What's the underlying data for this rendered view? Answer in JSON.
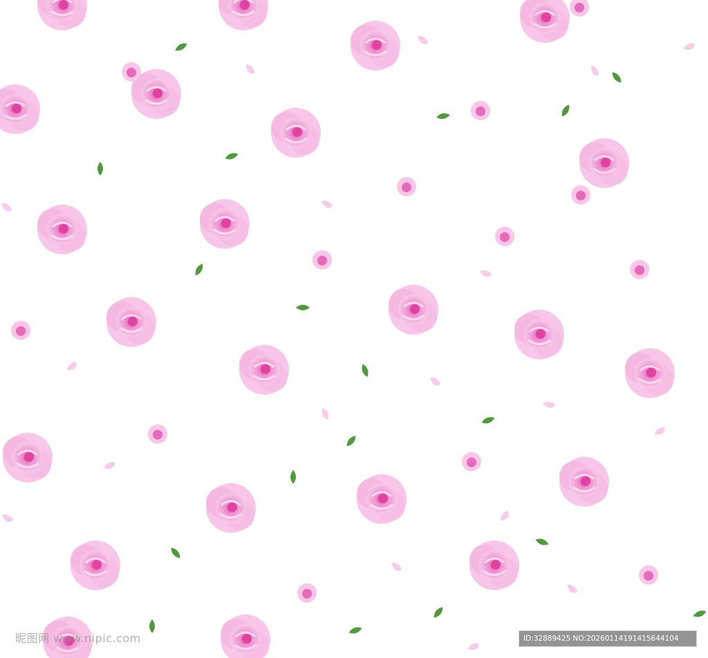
{
  "image": {
    "description_palette": {
      "background": "#ffffff",
      "rose_light": "#f6c2e6",
      "rose_mid": "#eda0d6",
      "rose_core": "#e0439f",
      "leaf": "#4f9a3a",
      "leaf_dark": "#2f6e22",
      "petal": "#f7cce9"
    }
  },
  "watermark": {
    "left_text": "昵图网 www.nipic.com",
    "right_text": "ID:32889425 NO:20260114191415644104"
  }
}
